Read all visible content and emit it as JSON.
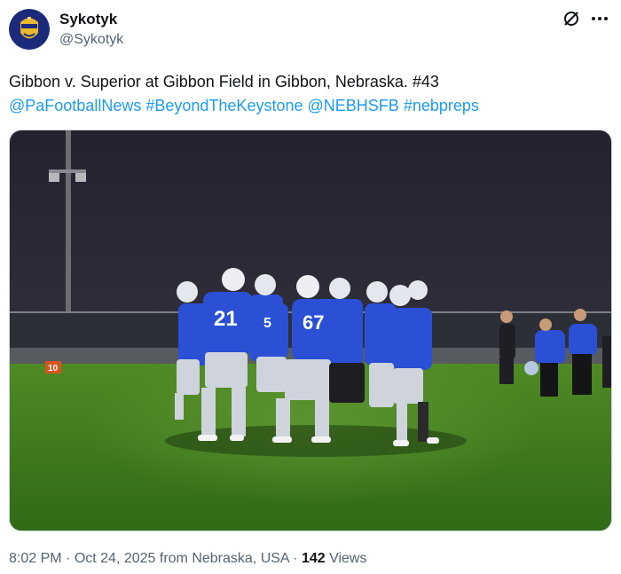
{
  "author": {
    "display_name": "Sykotyk",
    "handle": "@Sykotyk",
    "avatar_icon": "gold-mask-avatar-icon"
  },
  "header_icons": {
    "grok": "grok-slash-icon",
    "more": "more-dots-icon"
  },
  "post": {
    "line1": "Gibbon v. Superior at Gibbon Field in Gibbon, Nebraska. #43",
    "hashtags": [
      "@PaFootballNews",
      "#BeyondTheKeystone",
      "@NEBHSFB",
      "#nebpreps"
    ]
  },
  "media": {
    "description_icon": "football-team-photo",
    "field_marker": "10",
    "jersey_numbers": [
      "21",
      "67",
      "5"
    ]
  },
  "meta": {
    "time": "8:02 PM",
    "sep1": " · ",
    "date": "Oct 24, 2025",
    "location": " from Nebraska, USA",
    "sep2": " · ",
    "views_count": "142",
    "views_label": " Views"
  },
  "colors": {
    "link": "#1d9bf0",
    "jersey_blue": "#2b50d6",
    "grass": "#3f7a1e"
  }
}
